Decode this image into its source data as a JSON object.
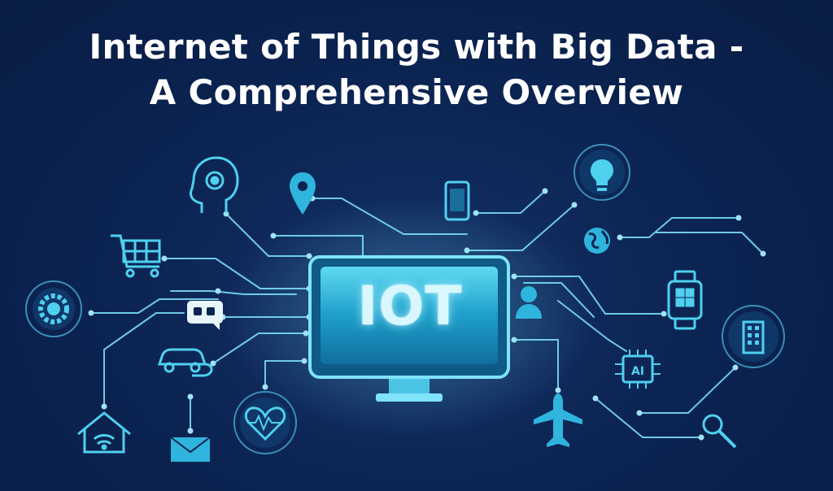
{
  "title": {
    "line1": "Internet of Things with Big Data -",
    "line2": "A Comprehensive Overview"
  },
  "center": {
    "label": "IOT",
    "icon": "monitor-icon"
  },
  "chip": {
    "label": "AI"
  },
  "icons": [
    "head-gear-icon",
    "location-pin-icon",
    "smartphone-icon",
    "lightbulb-icon",
    "globe-icon",
    "shopping-cart-icon",
    "gear-icon",
    "chat-bubble-icon",
    "user-icon",
    "smartwatch-icon",
    "building-icon",
    "electric-car-icon",
    "ai-chip-icon",
    "home-wifi-icon",
    "mail-icon",
    "heart-pulse-icon",
    "airplane-icon",
    "magnifier-icon"
  ],
  "colors": {
    "background": "#0b2350",
    "accent": "#4fd0ef",
    "line": "#6fc9e6",
    "screen": "#1aa8cf",
    "text": "#ffffff"
  }
}
